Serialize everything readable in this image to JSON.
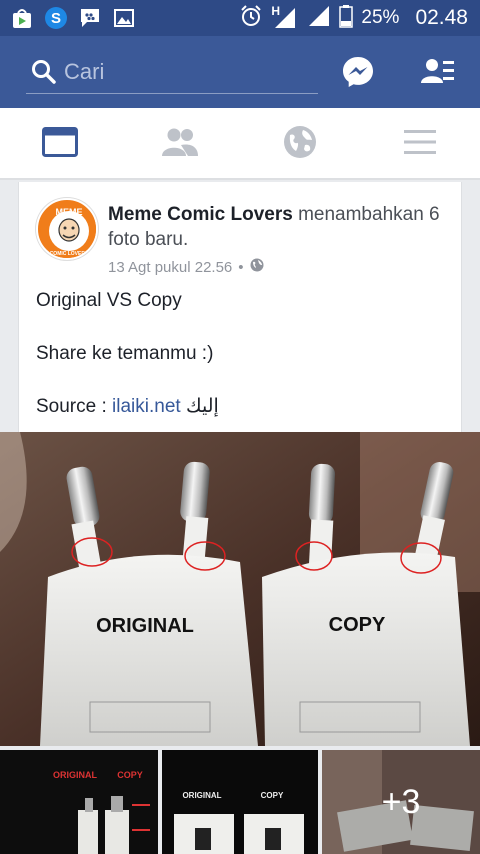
{
  "status_bar": {
    "battery": "25%",
    "time": "02.48",
    "network_label": "H"
  },
  "header": {
    "search_placeholder": "Cari"
  },
  "tabs": [
    {
      "name": "news-feed",
      "active": true
    },
    {
      "name": "friend-requests",
      "active": false
    },
    {
      "name": "notifications",
      "active": false
    },
    {
      "name": "more",
      "active": false
    }
  ],
  "post": {
    "page_name": "Meme Comic Lovers",
    "action_text": " menambahkan 6 foto baru.",
    "timestamp": "13 Agt pukul 22.56",
    "separator": "•",
    "line1": "Original VS Copy",
    "line2": "Share ke temanmu :)",
    "source_label": "Source : ",
    "source_link": "ilaiki.net",
    "source_arabic": "إليك",
    "avatar_top": "MEME",
    "avatar_bottom": "COMIC LOVERS"
  },
  "photos": {
    "main_label_left": "ORIGINAL",
    "main_label_right": "COPY",
    "thumb1_left": "ORIGINAL",
    "thumb1_right": "COPY",
    "thumb2_left": "ORIGINAL",
    "thumb2_right": "COPY",
    "more_count": "+3"
  },
  "colors": {
    "brand": "#3b5998",
    "status_bar": "#2e4a86",
    "link": "#365899"
  }
}
